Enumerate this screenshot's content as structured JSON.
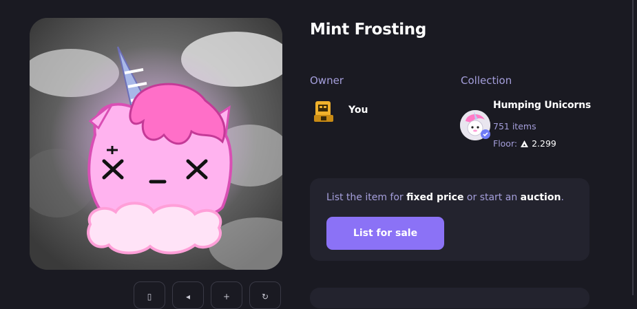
{
  "item": {
    "title": "Mint Frosting"
  },
  "owner": {
    "label": "Owner",
    "name": "You"
  },
  "collection": {
    "label": "Collection",
    "name": "Humping Unicorns",
    "items": "751 items",
    "floor_label": "Floor:",
    "floor_value": "2.299"
  },
  "sale": {
    "text_pre": "List the item for ",
    "text_fixed": "fixed price",
    "text_mid": " or start an ",
    "text_auction": "auction",
    "text_end": ".",
    "button_label": "List for sale"
  },
  "colors": {
    "accent": "#8b72f6",
    "muted": "#a59fdc",
    "background": "#1a1a22",
    "card": "#23232e"
  },
  "icons": [
    "save-icon",
    "send-icon",
    "upload-icon",
    "refresh-icon",
    "avalanche-icon",
    "verified-badge-icon"
  ]
}
